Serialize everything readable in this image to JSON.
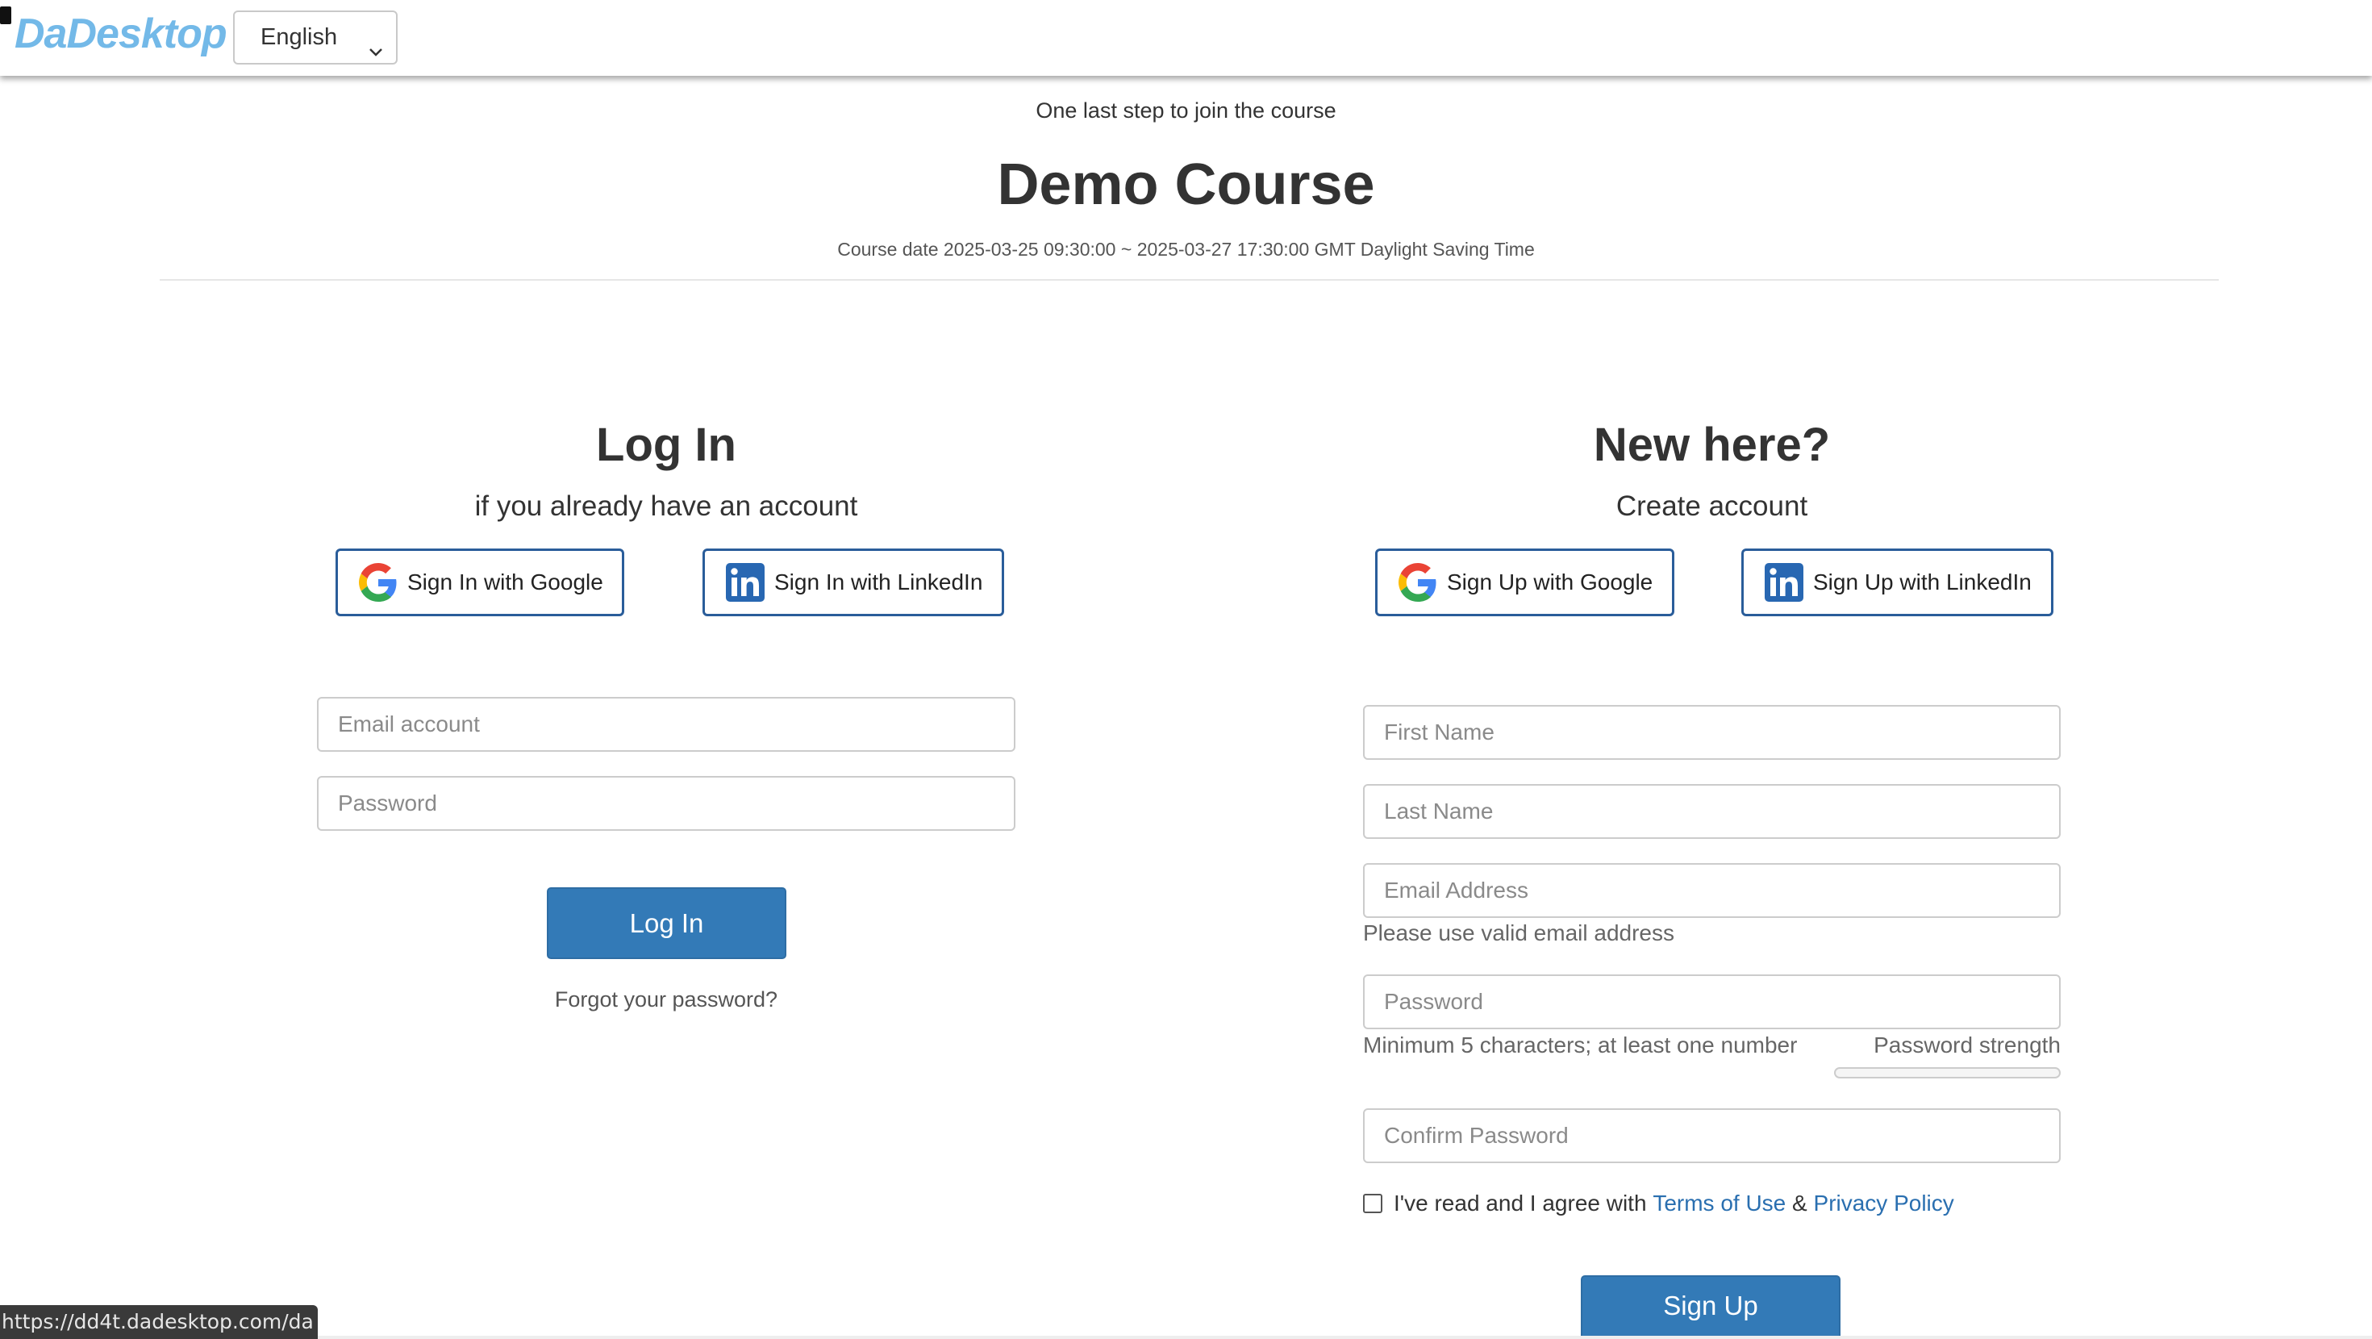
{
  "header": {
    "logo_text": "DaDesktop",
    "language": "English"
  },
  "course": {
    "pre_title": "One last step to join the course",
    "title": "Demo Course",
    "date_line": "Course date 2025-03-25 09:30:00 ~ 2025-03-27 17:30:00 GMT Daylight Saving Time"
  },
  "login": {
    "title": "Log In",
    "subtitle": "if you already have an account",
    "google_label": "Sign In with Google",
    "linkedin_label": "Sign In with LinkedIn",
    "email_placeholder": "Email account",
    "password_placeholder": "Password",
    "submit_label": "Log In",
    "forgot_label": "Forgot your password?"
  },
  "signup": {
    "title": "New here?",
    "subtitle": "Create account",
    "google_label": "Sign Up with Google",
    "linkedin_label": "Sign Up with LinkedIn",
    "first_name_placeholder": "First Name",
    "last_name_placeholder": "Last Name",
    "email_placeholder": "Email Address",
    "email_help": "Please use valid email address",
    "password_placeholder": "Password",
    "password_help": "Minimum 5 characters; at least one number",
    "password_strength_label": "Password strength",
    "password_strength_value": 0,
    "confirm_placeholder": "Confirm Password",
    "agree_prefix": "I've read and I agree with",
    "terms_label": "Terms of Use",
    "amp": "&",
    "privacy_label": "Privacy Policy",
    "submit_label": "Sign Up"
  },
  "status_bar": {
    "url": "https://dd4t.dadesktop.com/da"
  },
  "colors": {
    "primary": "#337ab7",
    "social_border": "#2a5d9a",
    "logo": "#73b9e8",
    "link": "#2a6fb0",
    "linkedin": "#2867b2"
  },
  "icons": {
    "google": "google-icon",
    "linkedin": "linkedin-icon",
    "dropdown": "chevron-down-icon"
  }
}
